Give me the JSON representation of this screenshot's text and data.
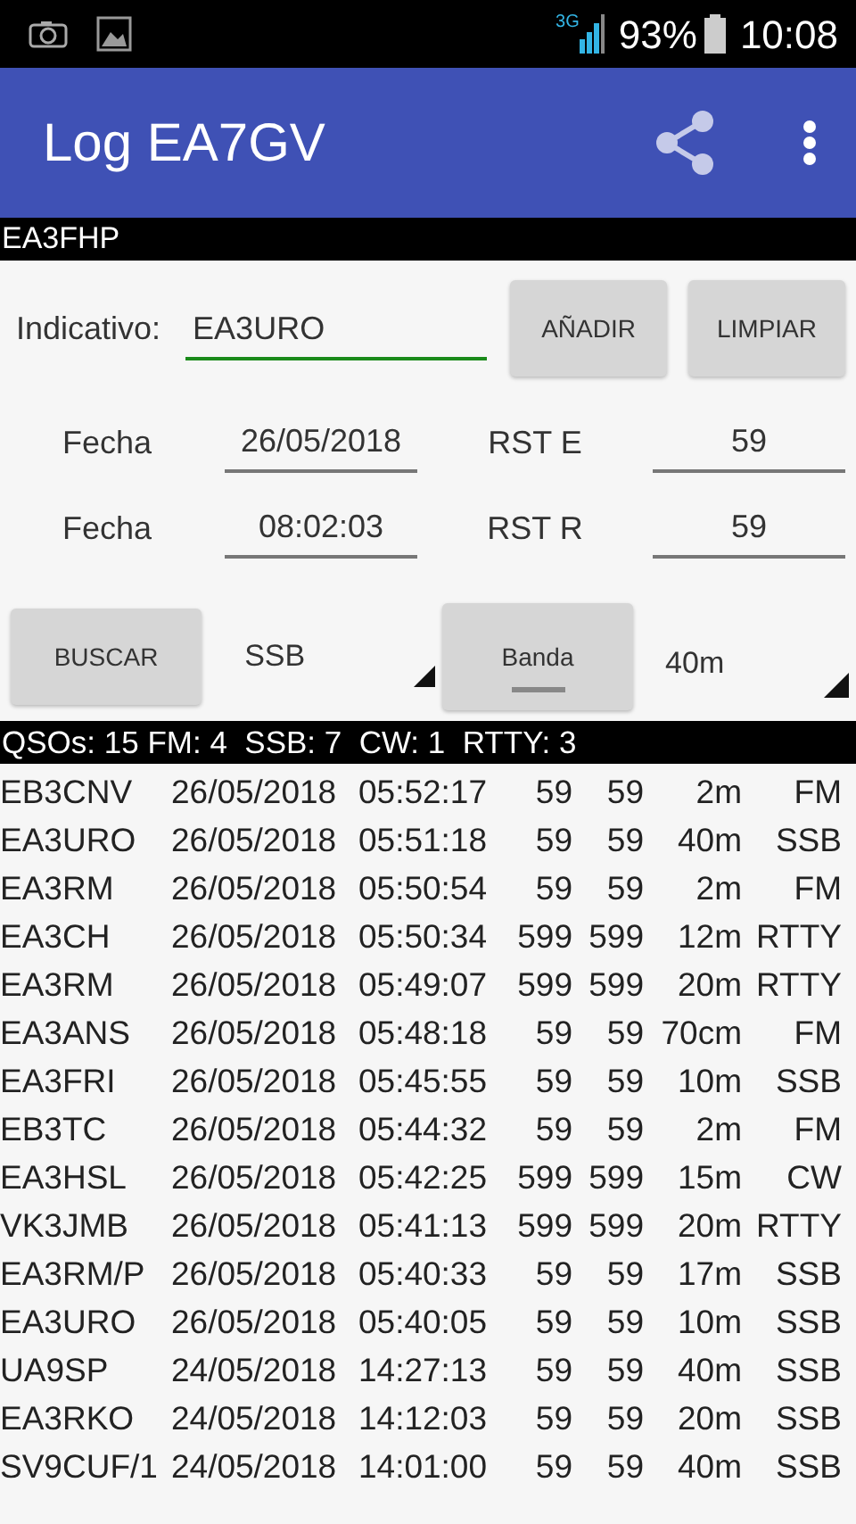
{
  "status_bar": {
    "network": "3G",
    "battery": "93%",
    "time": "10:08"
  },
  "app_bar": {
    "title": "Log EA7GV"
  },
  "operator": "EA3FHP",
  "form": {
    "call_label": "Indicativo:",
    "call_value": "EA3URO",
    "call_focused": true,
    "add_button": "AÑADIR",
    "clear_button": "LIMPIAR",
    "fields": [
      {
        "label": "Fecha",
        "value": "26/05/2018",
        "label2": "RST E",
        "value2": "59"
      },
      {
        "label": "Fecha",
        "value": "08:02:03",
        "label2": "RST R",
        "value2": "59"
      }
    ],
    "search_button": "BUSCAR",
    "mode_value": "SSB",
    "band_toggle": {
      "label": "Banda",
      "on": false
    },
    "band_value": "40m"
  },
  "summary": "QSOs: 15 FM: 4  SSB: 7  CW: 1  RTTY: 3",
  "log": [
    [
      "EB3CNV",
      "26/05/2018",
      "05:52:17",
      "59",
      "59",
      "2m",
      "FM"
    ],
    [
      "EA3URO",
      "26/05/2018",
      "05:51:18",
      "59",
      "59",
      "40m",
      "SSB"
    ],
    [
      "EA3RM",
      "26/05/2018",
      "05:50:54",
      "59",
      "59",
      "2m",
      "FM"
    ],
    [
      "EA3CH",
      "26/05/2018",
      "05:50:34",
      "599",
      "599",
      "12m",
      "RTTY"
    ],
    [
      "EA3RM",
      "26/05/2018",
      "05:49:07",
      "599",
      "599",
      "20m",
      "RTTY"
    ],
    [
      "EA3ANS",
      "26/05/2018",
      "05:48:18",
      "59",
      "59",
      "70cm",
      "FM"
    ],
    [
      "EA3FRI",
      "26/05/2018",
      "05:45:55",
      "59",
      "59",
      "10m",
      "SSB"
    ],
    [
      "EB3TC",
      "26/05/2018",
      "05:44:32",
      "59",
      "59",
      "2m",
      "FM"
    ],
    [
      "EA3HSL",
      "26/05/2018",
      "05:42:25",
      "599",
      "599",
      "15m",
      "CW"
    ],
    [
      "VK3JMB",
      "26/05/2018",
      "05:41:13",
      "599",
      "599",
      "20m",
      "RTTY"
    ],
    [
      "EA3RM/P",
      "26/05/2018",
      "05:40:33",
      "59",
      "59",
      "17m",
      "SSB"
    ],
    [
      "EA3URO",
      "26/05/2018",
      "05:40:05",
      "59",
      "59",
      "10m",
      "SSB"
    ],
    [
      "UA9SP",
      "24/05/2018",
      "14:27:13",
      "59",
      "59",
      "40m",
      "SSB"
    ],
    [
      "EA3RKO",
      "24/05/2018",
      "14:12:03",
      "59",
      "59",
      "20m",
      "SSB"
    ],
    [
      "SV9CUF/1",
      "24/05/2018",
      "14:01:00",
      "59",
      "59",
      "40m",
      "SSB"
    ]
  ]
}
